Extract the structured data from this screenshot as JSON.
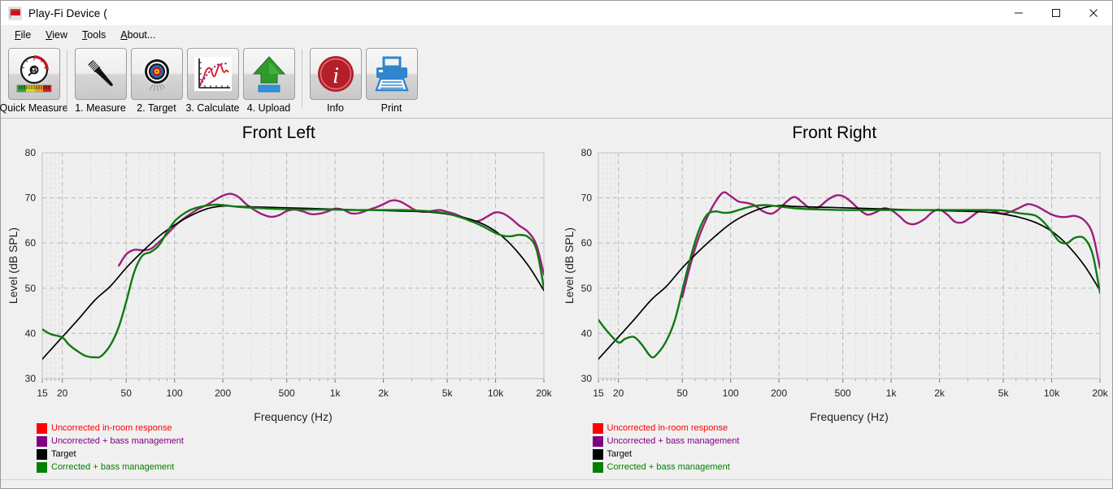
{
  "window": {
    "title": "Play-Fi Device (",
    "icon": "flag-icon",
    "controls": [
      {
        "name": "minimize-button",
        "glyph": "─"
      },
      {
        "name": "maximize-button",
        "glyph": "☐"
      },
      {
        "name": "close-button",
        "glyph": "✕"
      }
    ]
  },
  "menubar": {
    "items": [
      {
        "label": "File",
        "accel": "F"
      },
      {
        "label": "View",
        "accel": "V"
      },
      {
        "label": "Tools",
        "accel": "T"
      },
      {
        "label": "About...",
        "accel": "A"
      }
    ]
  },
  "toolbar": {
    "groups": [
      {
        "buttons": [
          {
            "label": "Quick Measure",
            "icon": "gauge-icon"
          }
        ]
      },
      {
        "buttons": [
          {
            "label": "1. Measure",
            "icon": "microphone-icon"
          },
          {
            "label": "2. Target",
            "icon": "target-icon"
          },
          {
            "label": "3. Calculate",
            "icon": "graph-icon"
          },
          {
            "label": "4. Upload",
            "icon": "upload-arrow-icon"
          }
        ]
      },
      {
        "buttons": [
          {
            "label": "Info",
            "icon": "info-icon"
          },
          {
            "label": "Print",
            "icon": "printer-icon"
          }
        ]
      }
    ]
  },
  "colors": {
    "uncorrected": "#fe0000",
    "bass_management": "#800080",
    "curve_magenta": "#9c1f7c",
    "target": "#000000",
    "corrected": "#008000",
    "curve_green": "#0f7a10",
    "plot_bg": "#efefef",
    "grid": "#c9c9c9",
    "frame": "#c0c0c0"
  },
  "legend": {
    "items": [
      {
        "label": "Uncorrected in-room response",
        "color": "#fe0000"
      },
      {
        "label": "Uncorrected + bass management",
        "color": "#800080"
      },
      {
        "label": "Target",
        "color": "#000000"
      },
      {
        "label": "Corrected + bass management",
        "color": "#008000"
      }
    ]
  },
  "chart_data": [
    {
      "type": "line",
      "title": "Front Left",
      "xlabel": "Frequency (Hz)",
      "ylabel": "Level (dB SPL)",
      "xscale": "log",
      "xlim": [
        15,
        20000
      ],
      "ylim": [
        30,
        80
      ],
      "yticks": [
        30,
        40,
        50,
        60,
        70,
        80
      ],
      "xticks": [
        15,
        20,
        50,
        100,
        200,
        500,
        1000,
        2000,
        5000,
        10000,
        20000
      ],
      "xticklabels": [
        "15",
        "20",
        "50",
        "100",
        "200",
        "500",
        "1k",
        "2k",
        "5k",
        "10k",
        "20k"
      ],
      "grid": true,
      "legend_position": "below-axes-left",
      "series": [
        {
          "name": "Target",
          "color": "#000000",
          "x": [
            15,
            20,
            25,
            32,
            40,
            50,
            63,
            80,
            100,
            125,
            160,
            200,
            250,
            315,
            400,
            500,
            630,
            800,
            1000,
            1250,
            1600,
            2000,
            2500,
            3150,
            4000,
            5000,
            6300,
            8000,
            10000,
            12500,
            16000,
            20000
          ],
          "values": [
            34.3,
            39.2,
            43.0,
            47.4,
            50.5,
            54.5,
            58.1,
            61.5,
            64.0,
            66.0,
            67.6,
            68.2,
            68.1,
            68.0,
            67.9,
            67.8,
            67.7,
            67.6,
            67.5,
            67.4,
            67.3,
            67.2,
            67.1,
            67.0,
            66.8,
            66.4,
            65.7,
            64.5,
            62.6,
            59.6,
            55.0,
            49.5
          ]
        },
        {
          "name": "Uncorrected + bass management",
          "color": "#9c1f7c",
          "x": [
            45,
            50,
            56,
            63,
            71,
            80,
            90,
            100,
            112,
            125,
            140,
            160,
            180,
            200,
            224,
            250,
            280,
            315,
            355,
            400,
            450,
            500,
            560,
            630,
            710,
            800,
            900,
            1000,
            1120,
            1250,
            1400,
            1600,
            1800,
            2000,
            2240,
            2500,
            2800,
            3150,
            3550,
            4000,
            4500,
            5000,
            5600,
            6300,
            7100,
            8000,
            9000,
            10000,
            11200,
            12500,
            14000,
            16000,
            18000,
            20000
          ],
          "values": [
            55.0,
            57.5,
            58.5,
            58.4,
            58.7,
            60.2,
            62.0,
            63.7,
            65.2,
            66.4,
            67.5,
            68.5,
            69.6,
            70.5,
            70.9,
            70.2,
            68.6,
            67.3,
            66.3,
            65.8,
            66.2,
            67.1,
            67.4,
            67.0,
            66.4,
            66.5,
            67.0,
            67.6,
            67.4,
            66.6,
            66.6,
            67.3,
            67.9,
            68.6,
            69.4,
            69.3,
            68.4,
            67.3,
            66.9,
            67.1,
            67.3,
            66.9,
            66.4,
            65.6,
            64.8,
            65.0,
            66.0,
            66.8,
            66.5,
            65.4,
            63.9,
            62.4,
            59.5,
            53.0
          ]
        },
        {
          "name": "Corrected + bass management",
          "color": "#0f7a10",
          "x": [
            15,
            17,
            20,
            22,
            25,
            28,
            32,
            35,
            40,
            45,
            50,
            56,
            63,
            71,
            80,
            90,
            100,
            112,
            125,
            140,
            160,
            180,
            200,
            250,
            315,
            400,
            500,
            630,
            800,
            1000,
            1250,
            1600,
            2000,
            2500,
            3150,
            4000,
            5000,
            6300,
            8000,
            10000,
            11200,
            12500,
            14000,
            16000,
            18000,
            20000
          ],
          "values": [
            40.9,
            39.8,
            39.1,
            37.5,
            36.0,
            35.0,
            34.7,
            35.0,
            37.5,
            41.5,
            47.0,
            53.5,
            57.2,
            58.0,
            59.5,
            62.5,
            64.8,
            66.3,
            67.3,
            67.9,
            68.3,
            68.5,
            68.4,
            68.0,
            67.8,
            67.6,
            67.5,
            67.4,
            67.4,
            67.4,
            67.3,
            67.3,
            67.3,
            67.3,
            67.2,
            67.0,
            66.5,
            65.5,
            64.0,
            62.2,
            61.6,
            61.5,
            61.8,
            61.3,
            58.5,
            50.0
          ]
        }
      ]
    },
    {
      "type": "line",
      "title": "Front Right",
      "xlabel": "Frequency (Hz)",
      "ylabel": "Level (dB SPL)",
      "xscale": "log",
      "xlim": [
        15,
        20000
      ],
      "ylim": [
        30,
        80
      ],
      "yticks": [
        30,
        40,
        50,
        60,
        70,
        80
      ],
      "xticks": [
        15,
        20,
        50,
        100,
        200,
        500,
        1000,
        2000,
        5000,
        10000,
        20000
      ],
      "xticklabels": [
        "15",
        "20",
        "50",
        "100",
        "200",
        "500",
        "1k",
        "2k",
        "5k",
        "10k",
        "20k"
      ],
      "grid": true,
      "legend_position": "below-axes-left",
      "series": [
        {
          "name": "Target",
          "color": "#000000",
          "x": [
            15,
            20,
            25,
            32,
            40,
            50,
            63,
            80,
            100,
            125,
            160,
            200,
            250,
            315,
            400,
            500,
            630,
            800,
            1000,
            1250,
            1600,
            2000,
            2500,
            3150,
            4000,
            5000,
            6300,
            8000,
            10000,
            12500,
            16000,
            20000
          ],
          "values": [
            34.3,
            39.2,
            43.0,
            47.4,
            50.5,
            54.5,
            58.1,
            61.5,
            64.3,
            66.3,
            67.8,
            68.3,
            68.1,
            68.0,
            67.9,
            67.8,
            67.7,
            67.6,
            67.5,
            67.4,
            67.3,
            67.2,
            67.1,
            67.0,
            66.8,
            66.4,
            65.7,
            64.5,
            62.6,
            59.6,
            55.0,
            49.5
          ]
        },
        {
          "name": "Uncorrected + bass management",
          "color": "#9c1f7c",
          "x": [
            50,
            56,
            63,
            71,
            80,
            90,
            100,
            112,
            125,
            140,
            160,
            180,
            200,
            224,
            250,
            280,
            315,
            355,
            400,
            450,
            500,
            560,
            630,
            710,
            800,
            900,
            1000,
            1120,
            1250,
            1400,
            1600,
            1800,
            2000,
            2240,
            2500,
            2800,
            3150,
            3550,
            4000,
            4500,
            5000,
            5600,
            6300,
            7100,
            8000,
            9000,
            10000,
            11200,
            12500,
            14000,
            16000,
            18000,
            20000
          ],
          "values": [
            48.0,
            55.0,
            61.0,
            65.5,
            69.0,
            71.2,
            70.4,
            69.2,
            68.9,
            68.4,
            67.0,
            66.5,
            67.5,
            69.2,
            70.2,
            69.0,
            67.6,
            68.0,
            69.5,
            70.5,
            70.4,
            69.2,
            67.5,
            66.3,
            66.8,
            67.7,
            67.3,
            66.0,
            64.5,
            64.2,
            65.2,
            66.8,
            67.4,
            66.3,
            64.7,
            64.6,
            65.8,
            67.1,
            67.3,
            66.9,
            66.5,
            67.0,
            67.8,
            68.6,
            68.2,
            67.2,
            66.3,
            65.8,
            65.8,
            66.0,
            65.0,
            62.0,
            54.5
          ]
        },
        {
          "name": "Corrected + bass management",
          "color": "#0f7a10",
          "x": [
            15,
            17,
            20,
            22,
            25,
            28,
            32,
            35,
            40,
            45,
            50,
            56,
            63,
            71,
            80,
            90,
            100,
            112,
            125,
            140,
            160,
            180,
            200,
            250,
            315,
            400,
            500,
            630,
            800,
            1000,
            1250,
            1600,
            2000,
            2500,
            3150,
            4000,
            5000,
            6300,
            7100,
            8000,
            9000,
            10000,
            11200,
            12500,
            14000,
            16000,
            18000,
            20000
          ],
          "values": [
            43.0,
            40.5,
            38.0,
            38.8,
            39.2,
            37.5,
            34.8,
            35.5,
            38.5,
            43.0,
            49.5,
            56.5,
            62.5,
            66.2,
            67.0,
            66.7,
            66.8,
            67.3,
            67.8,
            68.2,
            68.4,
            68.3,
            68.1,
            67.7,
            67.5,
            67.4,
            67.3,
            67.3,
            67.3,
            67.3,
            67.3,
            67.3,
            67.3,
            67.3,
            67.3,
            67.3,
            67.2,
            66.6,
            66.4,
            66.0,
            64.5,
            62.5,
            60.3,
            60.0,
            61.2,
            61.0,
            57.5,
            49.0
          ]
        }
      ]
    }
  ]
}
